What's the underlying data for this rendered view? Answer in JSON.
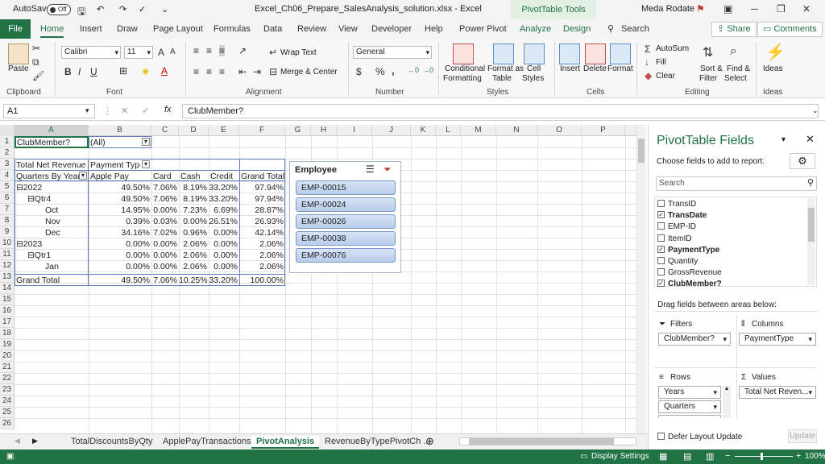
{
  "titlebar": {
    "autosave": "AutoSave",
    "toggle": "Off",
    "filename": "Excel_Ch06_Prepare_SalesAnalysis_solution.xlsx  -  Excel",
    "context": "PivotTable Tools",
    "user": "Meda Rodate"
  },
  "tabs": [
    "Home",
    "Insert",
    "Draw",
    "Page Layout",
    "Formulas",
    "Data",
    "Review",
    "View",
    "Developer",
    "Help",
    "Power Pivot",
    "Analyze",
    "Design"
  ],
  "file_tab": "File",
  "search": "Search",
  "share": "Share",
  "comments": "Comments",
  "ribbon": {
    "paste": "Paste",
    "font_name": "Calibri",
    "font_size": "11",
    "wrap_text": "Wrap Text",
    "merge_center": "Merge & Center",
    "number_format": "General",
    "cond_fmt": [
      "Conditional",
      "Formatting"
    ],
    "fmt_table": [
      "Format as",
      "Table"
    ],
    "cell_styles": [
      "Cell",
      "Styles"
    ],
    "insert": "Insert",
    "delete": "Delete",
    "format": "Format",
    "autosum": "AutoSum",
    "fill": "Fill",
    "clear": "Clear",
    "sort": [
      "Sort &",
      "Filter"
    ],
    "find": [
      "Find &",
      "Select"
    ],
    "ideas": "Ideas",
    "groups": [
      "Clipboard",
      "Font",
      "Alignment",
      "Number",
      "Styles",
      "Cells",
      "Editing",
      "Ideas"
    ]
  },
  "namebox": "A1",
  "formula": "ClubMember?",
  "columns": [
    "A",
    "B",
    "C",
    "D",
    "E",
    "F",
    "G",
    "H",
    "I",
    "J",
    "K",
    "L",
    "M",
    "N",
    "O",
    "P"
  ],
  "rows": [
    "1",
    "2",
    "3",
    "4",
    "5",
    "6",
    "7",
    "8",
    "9",
    "10",
    "11",
    "12",
    "13",
    "14",
    "15",
    "16",
    "17",
    "18",
    "19",
    "20",
    "21",
    "22",
    "23",
    "24",
    "25",
    "26"
  ],
  "pivot": {
    "filter_label": "ClubMember?",
    "filter_value": "(All)",
    "values_label": "Total Net Revenue",
    "col_header": "Payment Type",
    "row_header": "Quarters By Year",
    "col_names": [
      "Apple Pay",
      "Card",
      "Cash",
      "Credit",
      "Grand Total"
    ],
    "body": [
      {
        "label": "⊟2022",
        "v": [
          "49.50%",
          "7.06%",
          "8.19%",
          "33.20%",
          "97.94%"
        ]
      },
      {
        "label": "⊟Qtr4",
        "v": [
          "49.50%",
          "7.06%",
          "8.19%",
          "33.20%",
          "97.94%"
        ]
      },
      {
        "label": "Oct",
        "v": [
          "14.95%",
          "0.00%",
          "7.23%",
          "6.69%",
          "28.87%"
        ]
      },
      {
        "label": "Nov",
        "v": [
          "0.39%",
          "0.03%",
          "0.00%",
          "26.51%",
          "26.93%"
        ]
      },
      {
        "label": "Dec",
        "v": [
          "34.16%",
          "7.02%",
          "0.96%",
          "0.00%",
          "42.14%"
        ]
      },
      {
        "label": "⊟2023",
        "v": [
          "0.00%",
          "0.00%",
          "2.06%",
          "0.00%",
          "2.06%"
        ]
      },
      {
        "label": "⊟Qtr1",
        "v": [
          "0.00%",
          "0.00%",
          "2.06%",
          "0.00%",
          "2.06%"
        ]
      },
      {
        "label": "Jan",
        "v": [
          "0.00%",
          "0.00%",
          "2.06%",
          "0.00%",
          "2.06%"
        ]
      },
      {
        "label": "Grand Total",
        "v": [
          "49.50%",
          "7.06%",
          "10.25%",
          "33.20%",
          "100.00%"
        ]
      }
    ]
  },
  "slicer": {
    "title": "Employee",
    "items": [
      "EMP-00015",
      "EMP-00024",
      "EMP-00026",
      "EMP-00038",
      "EMP-00076"
    ]
  },
  "sheets": [
    "TotalDiscountsByQty",
    "ApplePayTransactions",
    "PivotAnalysis",
    "RevenueByTypePivotCh ..."
  ],
  "pane": {
    "title": "PivotTable Fields",
    "subtitle": "Choose fields to add to report:",
    "search": "Search",
    "fields": [
      {
        "n": "TransID",
        "c": false
      },
      {
        "n": "TransDate",
        "c": true
      },
      {
        "n": "EMP-ID",
        "c": false
      },
      {
        "n": "ItemID",
        "c": false
      },
      {
        "n": "PaymentType",
        "c": true
      },
      {
        "n": "Quantity",
        "c": false
      },
      {
        "n": "GrossRevenue",
        "c": false
      },
      {
        "n": "ClubMember?",
        "c": true
      }
    ],
    "drag": "Drag fields between areas below:",
    "filters": "Filters",
    "columns": "Columns",
    "rows": "Rows",
    "values": "Values",
    "filter_item": "ClubMember?",
    "column_item": "PaymentType",
    "row_items": [
      "Years",
      "Quarters"
    ],
    "value_item": "Total Net Reven...",
    "defer": "Defer Layout Update",
    "update": "Update"
  },
  "status": {
    "display": "Display Settings",
    "zoom": "100%"
  }
}
